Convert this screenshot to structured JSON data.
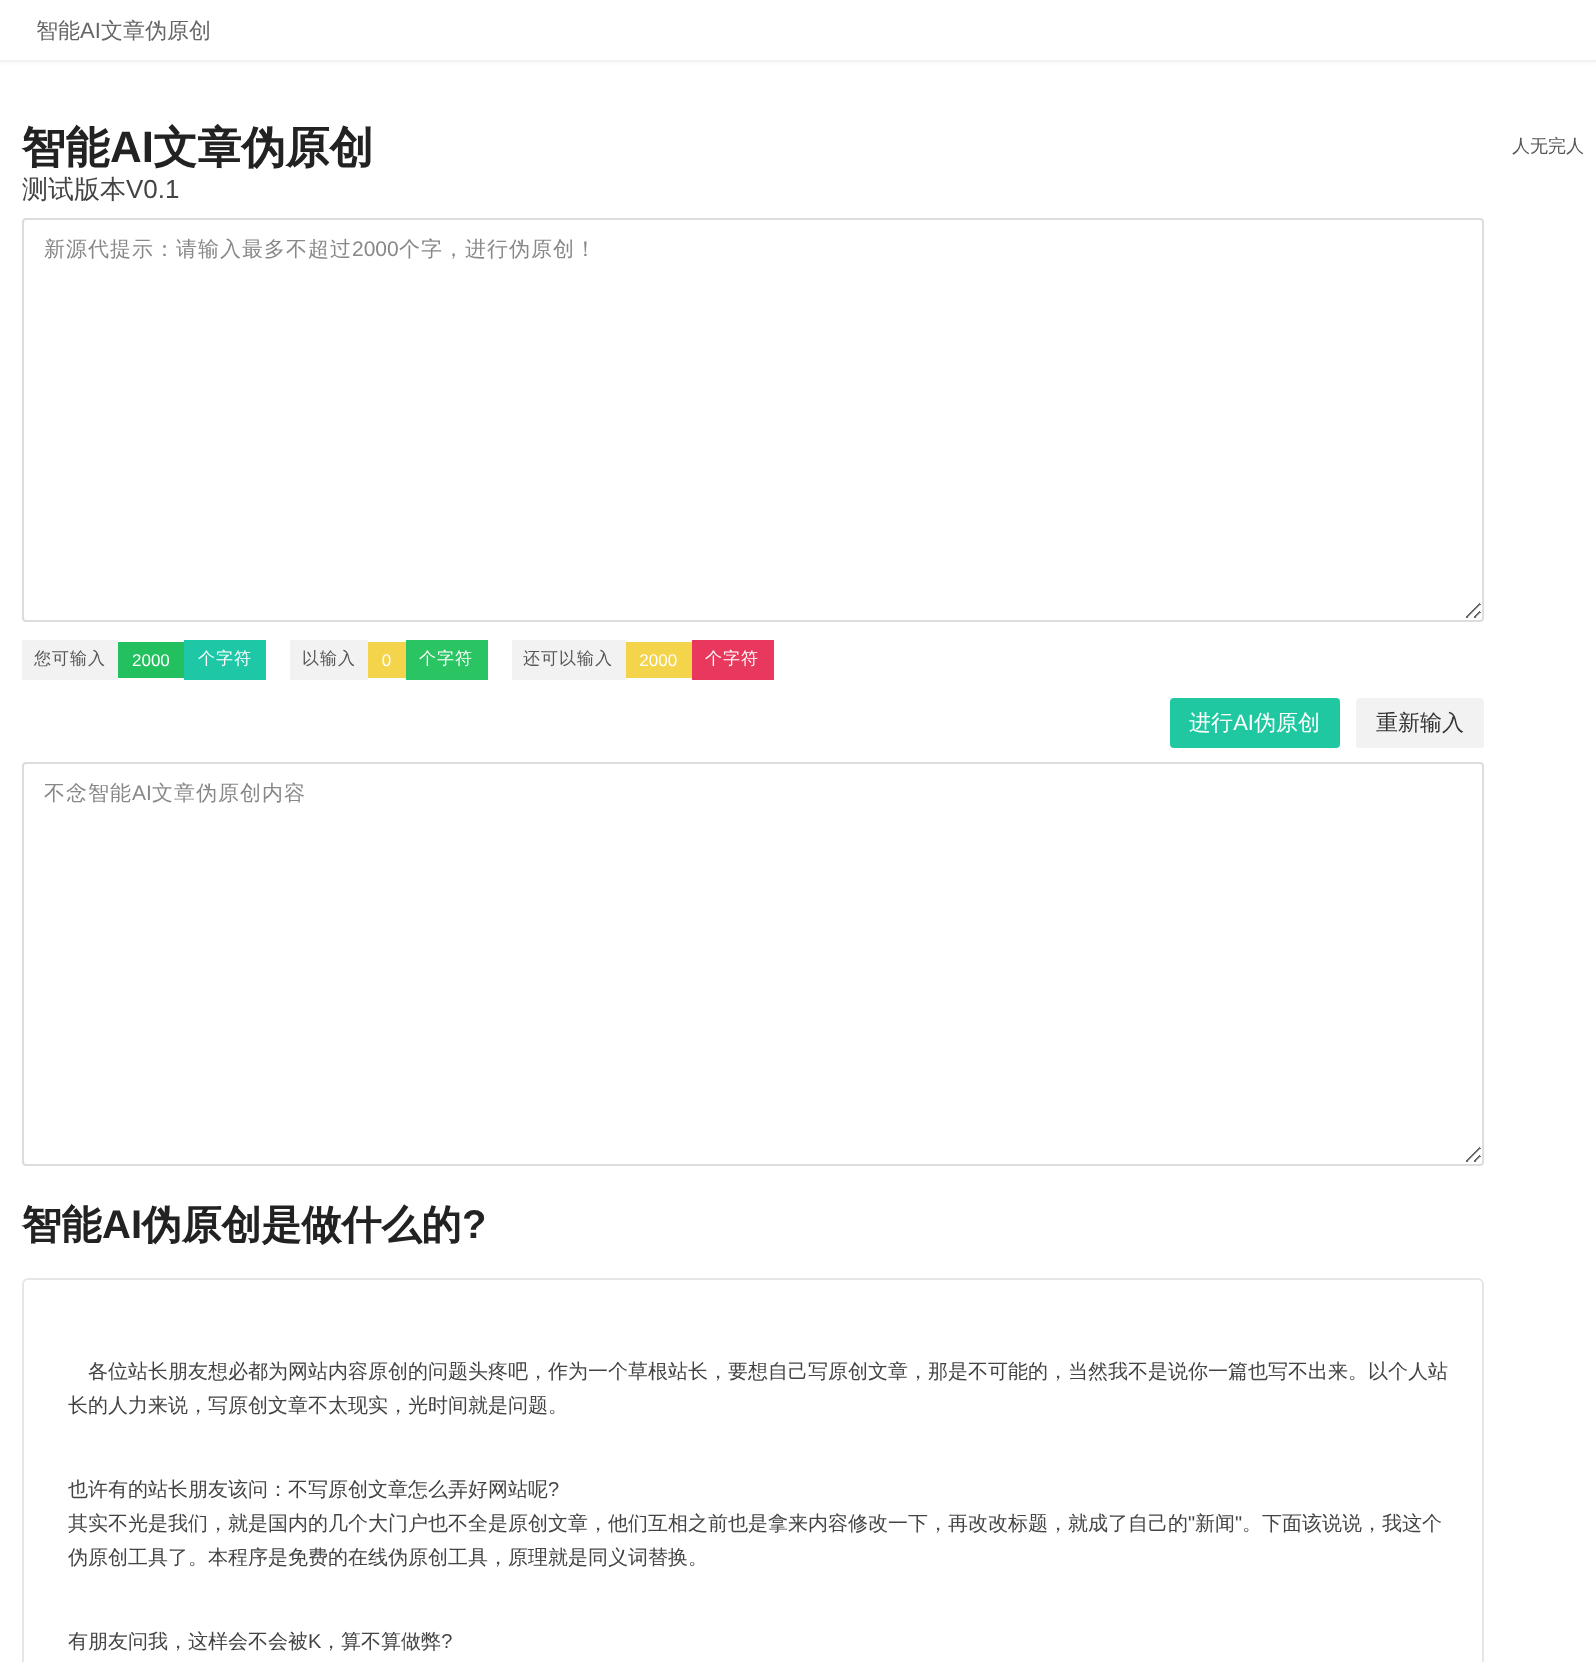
{
  "header": {
    "title": "智能AI文章伪原创"
  },
  "side_note": "人无完人",
  "title": "智能AI文章伪原创",
  "subtitle": "测试版本V0.1",
  "input": {
    "placeholder": "新源代提示：请输入最多不超过2000个字，进行伪原创！"
  },
  "counters": [
    {
      "label": "您可输入",
      "badges": [
        {
          "text": "2000",
          "color": "#22c05f"
        },
        {
          "text": "个字符",
          "color": "#1ec8a6"
        }
      ]
    },
    {
      "label": "以输入",
      "badges": [
        {
          "text": "0",
          "color": "#f4d44a"
        },
        {
          "text": "个字符",
          "color": "#2ac462"
        }
      ]
    },
    {
      "label": "还可以输入",
      "badges": [
        {
          "text": "2000",
          "color": "#f4d44a"
        },
        {
          "text": "个字符",
          "color": "#e8385d"
        }
      ]
    }
  ],
  "buttons": [
    {
      "label": "进行AI伪原创",
      "kind": "primary"
    },
    {
      "label": "重新输入",
      "kind": "secondary"
    }
  ],
  "output": {
    "placeholder": "不念智能AI文章伪原创内容"
  },
  "section_title": "智能AI伪原创是做什么的?",
  "article": [
    {
      "lines": [
        "　各位站长朋友想必都为网站内容原创的问题头疼吧，作为一个草根站长，要想自己写原创文章，那是不可能的，当然我不是说你一篇也写不出来。以个人站长的人力来说，写原创文章不太现实，光时间就是问题。"
      ]
    },
    {
      "lines": [
        "也许有的站长朋友该问：不写原创文章怎么弄好网站呢?",
        "其实不光是我们，就是国内的几个大门户也不全是原创文章，他们互相之前也是拿来内容修改一下，再改改标题，就成了自己的\"新闻\"。下面该说说，我这个伪原创工具了。本程序是免费的在线伪原创工具，原理就是同义词替换。"
      ]
    },
    {
      "lines": [
        "有朋友问我，这样会不会被K，算不算做弊?"
      ]
    }
  ]
}
